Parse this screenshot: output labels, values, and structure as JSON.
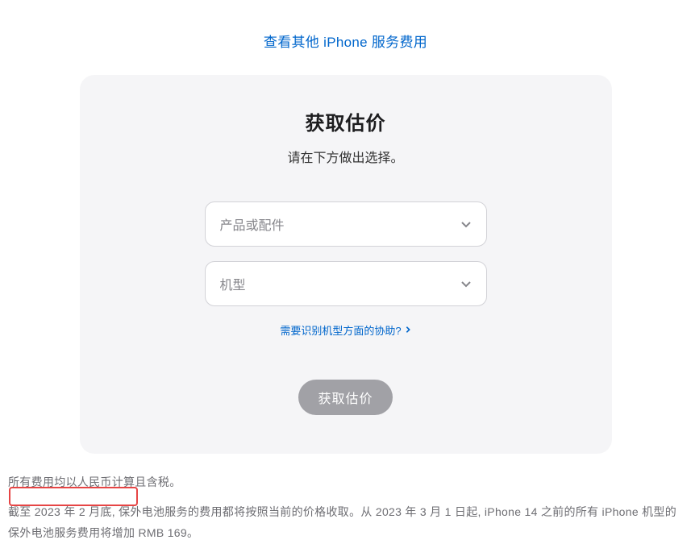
{
  "topLink": {
    "label": "查看其他 iPhone 服务费用"
  },
  "card": {
    "title": "获取估价",
    "subtitle": "请在下方做出选择。",
    "productSelect": {
      "placeholder": "产品或配件"
    },
    "modelSelect": {
      "placeholder": "机型"
    },
    "helpLink": {
      "label": "需要识别机型方面的协助?"
    },
    "submitButton": {
      "label": "获取估价"
    }
  },
  "footer": {
    "note1": "所有费用均以人民币计算且含税。",
    "note2": "截至 2023 年 2 月底, 保外电池服务的费用都将按照当前的价格收取。从 2023 年 3 月 1 日起, iPhone 14 之前的所有 iPhone 机型的保外电池服务费用将增加 RMB 169。"
  }
}
